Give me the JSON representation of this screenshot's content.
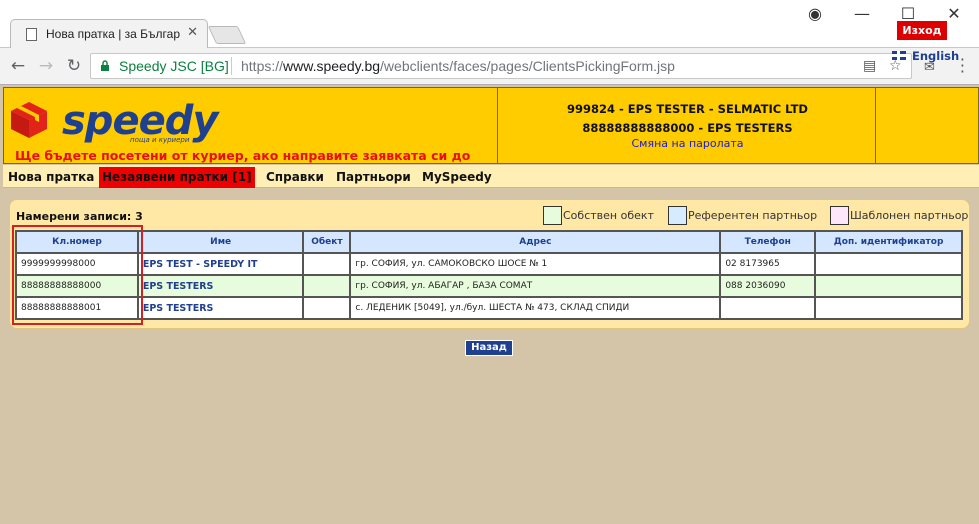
{
  "browser": {
    "tab_title": "Нова пратка | за Българ",
    "site_name": "Speedy JSC [BG]",
    "url_scheme": "https://",
    "url_host": "www.speedy.bg",
    "url_path": "/webclients/faces/pages/ClientsPickingForm.jsp"
  },
  "header": {
    "logo_text": "speedy",
    "logo_tagline": "поща и куриери",
    "notice": "Ще бъдете посетени от куриер, ако направите заявката си до",
    "account_line1": "999824 - EPS TESTER - SELMATIC LTD",
    "account_line2": "88888888888000 - EPS TESTERS",
    "change_password": "Смяна на паролата",
    "logout_label": "Изход",
    "language_label": "English"
  },
  "menu": {
    "items": [
      {
        "label": "Нова пратка"
      },
      {
        "label": "Незаявени пратки [1]"
      },
      {
        "label": "Справки"
      },
      {
        "label": "Партньори"
      },
      {
        "label": "MySpeedy"
      }
    ]
  },
  "results": {
    "found_label": "Намерени записи: 3",
    "legend": [
      {
        "label": "Собствен обект",
        "color": "#e6fcdc"
      },
      {
        "label": "Референтен партньор",
        "color": "#d5ecff"
      },
      {
        "label": "Шаблонен партньор",
        "color": "#fde6fa"
      }
    ],
    "columns": [
      "Кл.номер",
      "Име",
      "Обект",
      "Адрес",
      "Телефон",
      "Доп. идентификатор"
    ],
    "rows": [
      {
        "client_no": "9999999998000",
        "name": "EPS TEST - SPEEDY IT",
        "object": "",
        "address": "гр. СОФИЯ, ул. САМОКОВСКО ШОСЕ № 1",
        "phone": "02 8173965",
        "extra_id": ""
      },
      {
        "client_no": "88888888888000",
        "name": "EPS TESTERS",
        "object": "",
        "address": "гр. СОФИЯ, ул. АБАГАР , БАЗА СОМАТ",
        "phone": "088 2036090",
        "extra_id": ""
      },
      {
        "client_no": "88888888888001",
        "name": "EPS TESTERS",
        "object": "",
        "address": "с. ЛЕДЕНИК [5049], ул./бул. ШЕСТА № 473, СКЛАД СПИДИ",
        "phone": "",
        "extra_id": ""
      }
    ],
    "back_label": "Назад"
  }
}
